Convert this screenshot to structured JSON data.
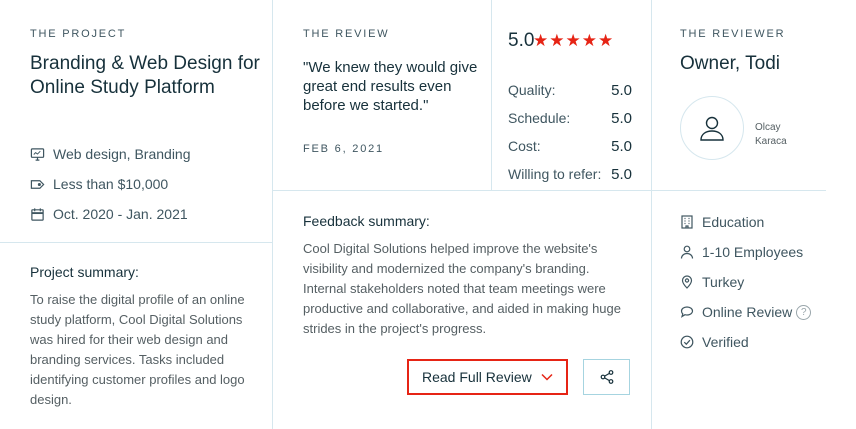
{
  "project": {
    "label": "THE PROJECT",
    "title": "Branding & Web Design for Online Study Platform",
    "services": "Web design, Branding",
    "budget": "Less than $10,000",
    "dates": "Oct. 2020 - Jan. 2021",
    "summary_label": "Project summary:",
    "summary": "To raise the digital profile of an online study platform, Cool Digital Solutions was hired for their web design and branding services. Tasks included identifying customer profiles and logo design."
  },
  "review": {
    "label": "THE REVIEW",
    "quote": "\"We knew they would give great end results even before we started.\"",
    "date": "FEB 6, 2021",
    "overall": "5.0",
    "stars": 5,
    "star_color": "#e62415",
    "ratings": [
      {
        "label": "Quality:",
        "value": "5.0"
      },
      {
        "label": "Schedule:",
        "value": "5.0"
      },
      {
        "label": "Cost:",
        "value": "5.0"
      },
      {
        "label": "Willing to refer:",
        "value": "5.0"
      }
    ],
    "feedback_label": "Feedback summary:",
    "feedback": "Cool Digital Solutions helped improve the website's visibility and modernized the company's branding. Internal stakeholders noted that team meetings were productive and collaborative, and aided in making huge strides in the project's progress.",
    "read_button": "Read Full Review"
  },
  "reviewer": {
    "label": "THE REVIEWER",
    "name": "Owner, Todi",
    "avatar_line1": "Olcay",
    "avatar_line2": "Karaca",
    "industry": "Education",
    "size": "1-10 Employees",
    "location": "Turkey",
    "review_type": "Online Review",
    "verified": "Verified"
  },
  "icons": [
    "monitor-icon",
    "tag-icon",
    "calendar-icon",
    "chevron-down-icon",
    "share-icon",
    "user-icon",
    "building-icon",
    "person-icon",
    "location-pin-icon",
    "chat-bubble-icon",
    "check-circle-icon",
    "help-icon"
  ]
}
